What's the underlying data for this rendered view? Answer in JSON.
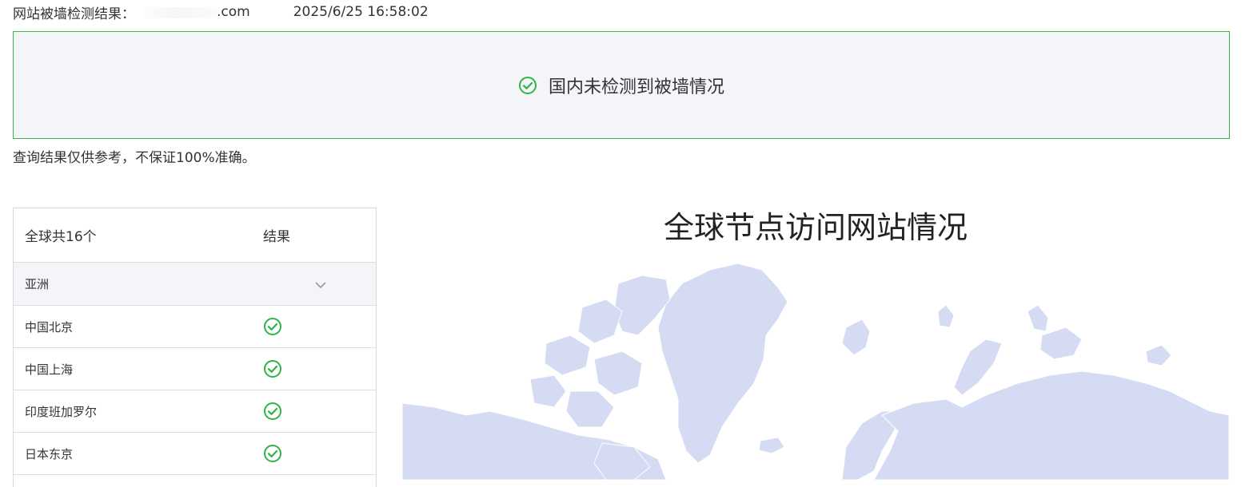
{
  "header": {
    "label": "网站被墙检测结果：",
    "domain_suffix": ".com",
    "timestamp": "2025/6/25 16:58:02"
  },
  "status": {
    "icon": "check-circle-icon",
    "message": "国内未检测到被墙情况",
    "border_color": "#3bb54a",
    "icon_color": "#2fb344"
  },
  "disclaimer": "查询结果仅供参考，不保证100%准确。",
  "table": {
    "headers": [
      "全球共16个",
      "结果"
    ],
    "groups": [
      {
        "name": "亚洲",
        "rows": [
          {
            "location": "中国北京",
            "result": "check-circle-icon"
          },
          {
            "location": "中国上海",
            "result": "check-circle-icon"
          },
          {
            "location": "印度班加罗尔",
            "result": "check-circle-icon"
          },
          {
            "location": "日本东京",
            "result": "check-circle-icon"
          }
        ]
      }
    ]
  },
  "map": {
    "title": "全球节点访问网站情况",
    "land_color": "#d5dbf2"
  }
}
